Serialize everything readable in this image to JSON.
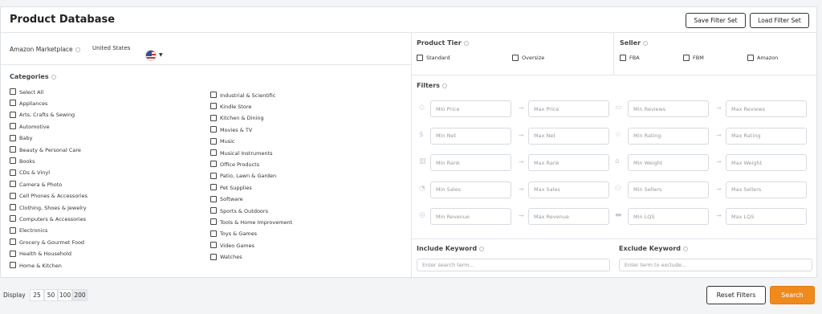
{
  "header": {
    "title": "Product Database",
    "save_filter_label": "Save Filter Set",
    "load_filter_label": "Load Filter Set"
  },
  "marketplace": {
    "label": "Amazon Marketplace",
    "value": "United States",
    "flag_icon": "us-flag-icon"
  },
  "categories": {
    "label": "Categories",
    "left": [
      "Select All",
      "Appliances",
      "Arts, Crafts & Sewing",
      "Automotive",
      "Baby",
      "Beauty & Personal Care",
      "Books",
      "CDs & Vinyl",
      "Camera & Photo",
      "Cell Phones & Accessories",
      "Clothing, Shoes & Jewelry",
      "Computers & Accessories",
      "Electronics",
      "Grocery & Gourmet Food",
      "Health & Household",
      "Home & Kitchen"
    ],
    "right": [
      "Industrial & Scientific",
      "Kindle Store",
      "Kitchen & Dining",
      "Movies & TV",
      "Music",
      "Musical Instruments",
      "Office Products",
      "Patio, Lawn & Garden",
      "Pet Supplies",
      "Software",
      "Sports & Outdoors",
      "Tools & Home Improvement",
      "Toys & Games",
      "Video Games",
      "Watches"
    ]
  },
  "product_tier": {
    "label": "Product Tier",
    "options": [
      "Standard",
      "Oversize"
    ]
  },
  "seller": {
    "label": "Seller",
    "options": [
      "FBA",
      "FBM",
      "Amazon"
    ]
  },
  "filters": {
    "label": "Filters",
    "rows": [
      {
        "icon": "tag-icon",
        "min": "Min Price",
        "max": "Max Price",
        "icon2": "comment-icon",
        "min2": "Min Reviews",
        "max2": "Max Reviews"
      },
      {
        "icon": "dollar-icon",
        "min": "Min Net",
        "max": "Max Net",
        "icon2": "star-icon",
        "min2": "Min Rating",
        "max2": "Max Rating"
      },
      {
        "icon": "bar-chart-icon",
        "min": "Min Rank",
        "max": "Max Rank",
        "icon2": "weight-icon",
        "min2": "Min Weight",
        "max2": "Max Weight"
      },
      {
        "icon": "sales-icon",
        "min": "Min Sales",
        "max": "Max Sales",
        "icon2": "users-icon",
        "min2": "Min Sellers",
        "max2": "Max Sellers"
      },
      {
        "icon": "revenue-icon",
        "min": "Min Revenue",
        "max": "Max Revenue",
        "icon2": "quality-icon",
        "min2": "Min LQS",
        "max2": "Max LQS"
      }
    ]
  },
  "include_keyword": {
    "label": "Include Keyword",
    "placeholder": "Enter search term..."
  },
  "exclude_keyword": {
    "label": "Exclude Keyword",
    "placeholder": "Enter term to exclude..."
  },
  "footer": {
    "display_label": "Display",
    "page_sizes": [
      "25",
      "50",
      "100",
      "200"
    ],
    "selected_page_size": "200",
    "reset_label": "Reset Filters",
    "search_label": "Search"
  },
  "colors": {
    "accent": "#f08a1c",
    "border": "#dde1e6"
  }
}
